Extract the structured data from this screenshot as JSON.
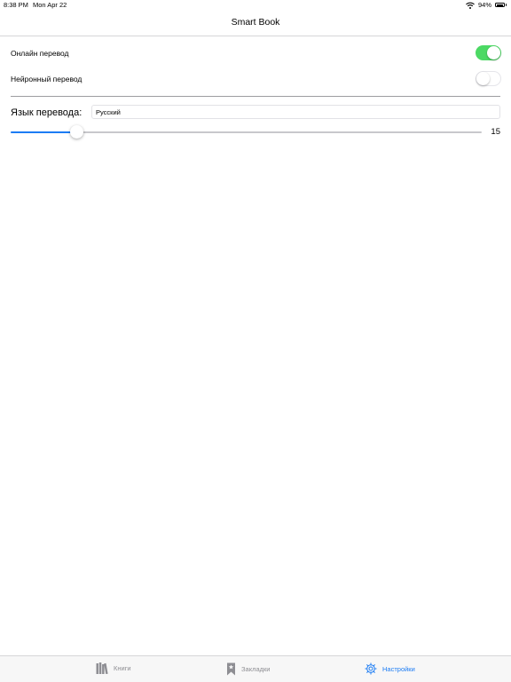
{
  "status_bar": {
    "time": "8:38 PM",
    "date": "Mon Apr 22",
    "battery": "94%",
    "battery_level": 0.94
  },
  "nav": {
    "title": "Smart Book"
  },
  "settings": {
    "online_translation": {
      "label": "Онлайн перевод",
      "enabled": true
    },
    "neural_translation": {
      "label": "Нейронный перевод",
      "enabled": false
    },
    "language": {
      "label": "Язык перевода:",
      "value": "Русский"
    },
    "slider": {
      "value": "15",
      "fraction": 0.14
    }
  },
  "tabs": [
    {
      "label": "Книги",
      "icon": "books-icon",
      "active": false
    },
    {
      "label": "Закладки",
      "icon": "bookmark-icon",
      "active": false
    },
    {
      "label": "Настройки",
      "icon": "gear-icon",
      "active": true
    }
  ],
  "colors": {
    "accent": "#1c7cf4",
    "toggle_on": "#4cd964",
    "inactive": "#8e8e93"
  }
}
